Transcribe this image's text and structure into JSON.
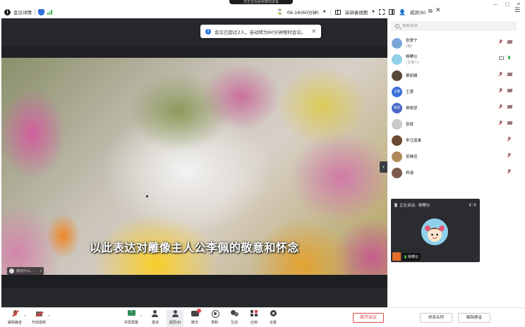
{
  "share_banner": "您正在观看杨攀的屏幕",
  "topbar": {
    "meeting_details": "会议详情",
    "timer": "06:16(60分钟)",
    "view_mode": "演讲者视图",
    "members_count": "成员(9)"
  },
  "toast": {
    "message": "会议已超过2人，自动转为60分钟限时会议。"
  },
  "stage": {
    "subtitle": "以此表达对雕像主人公李佩的敬意和怀念",
    "speaker_chip": "微动什么..."
  },
  "panel": {
    "search_placeholder": "搜索成员",
    "members": [
      {
        "name": "张爱宁",
        "role": "(我)",
        "avatar_text": "",
        "avatar_color": "#7aa7d6",
        "mic": "off",
        "cam": "off"
      },
      {
        "name": "杨攀仪",
        "role": "(主持人)",
        "avatar_text": "",
        "avatar_color": "#8fd1ea",
        "mic": "on",
        "cam": "screen"
      },
      {
        "name": "蔡丽娟",
        "role": "",
        "avatar_text": "",
        "avatar_color": "#5a4a3a",
        "mic": "off",
        "cam": "off"
      },
      {
        "name": "王惠",
        "role": "",
        "avatar_text": "王惠",
        "avatar_color": "#3b6fd6",
        "mic": "off",
        "cam": "off"
      },
      {
        "name": "杨皓坚",
        "role": "",
        "avatar_text": "皓坚",
        "avatar_color": "#4a68c9",
        "mic": "off",
        "cam": "off"
      },
      {
        "name": "张斌",
        "role": "",
        "avatar_text": "",
        "avatar_color": "#c9c9c9",
        "mic": "off",
        "cam": "off"
      },
      {
        "name": "李汪迦乘",
        "role": "",
        "avatar_text": "",
        "avatar_color": "#6b4a2f",
        "mic": "off",
        "cam": ""
      },
      {
        "name": "吴琳佳",
        "role": "",
        "avatar_text": "",
        "avatar_color": "#b08a5a",
        "mic": "off",
        "cam": ""
      },
      {
        "name": "梓涵",
        "role": "",
        "avatar_text": "",
        "avatar_color": "#7c5a4a",
        "mic": "off",
        "cam": ""
      }
    ],
    "speaking_label": "正在讲话:",
    "speaking_name": "杨攀仪",
    "tile_name": "杨攀仪"
  },
  "toolbar": {
    "unmute": "解除静音",
    "start_video": "开启视频",
    "share_screen": "共享屏幕",
    "invite": "邀请",
    "members": "成员(9)",
    "chat": "聊天",
    "record": "录制",
    "interact": "互动",
    "apps": "应用",
    "settings": "设置",
    "leave": "离开会议",
    "rename": "修改名称",
    "unmute_all": "解除静音"
  },
  "colors": {
    "accent_blue": "#2f6fde",
    "danger_red": "#e0454a",
    "green": "#3cb34a",
    "stage_bg": "#26282c"
  }
}
